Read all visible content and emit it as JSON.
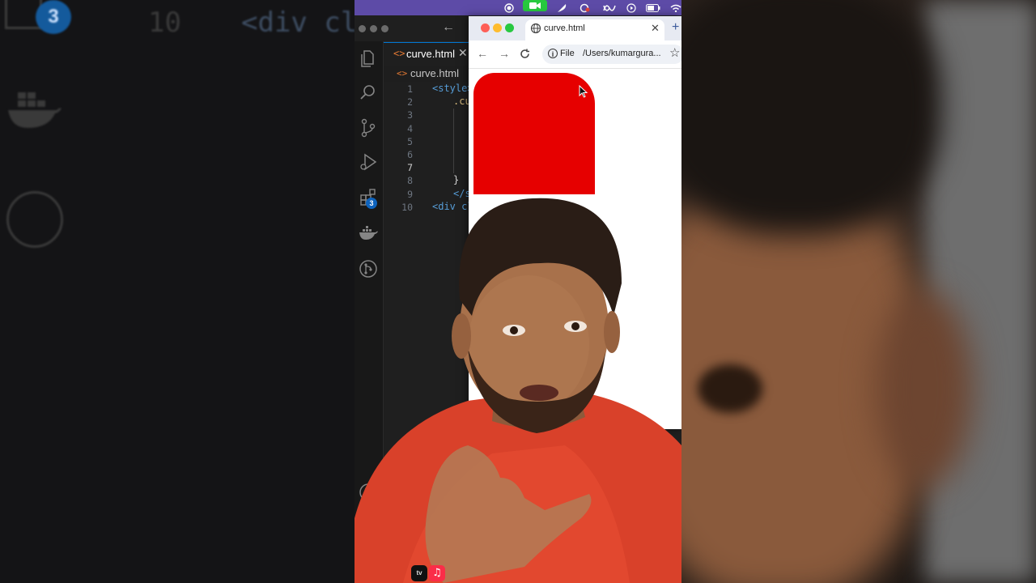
{
  "vscode": {
    "tab_label": "curve.html",
    "breadcrumb_file": "curve.html",
    "ext_badge": "3",
    "line_numbers": [
      "1",
      "2",
      "3",
      "4",
      "5",
      "6",
      "7",
      "8",
      "9",
      "10"
    ],
    "code_lines": {
      "l1": "<style>",
      "l2": ".cu",
      "l8": "}",
      "l9": "</s",
      "l10": "<div cl"
    }
  },
  "ghost": {
    "line_number": "10",
    "code": "<div cl",
    "badge": "3"
  },
  "browser": {
    "tab_title": "curve.html",
    "file_label": "File",
    "url": "/Users/kumargura..."
  },
  "dock": {
    "tv_label": "tv"
  },
  "colors": {
    "box": "#e60000",
    "menubar": "#5d4ba7",
    "accent": "#0078d4"
  }
}
